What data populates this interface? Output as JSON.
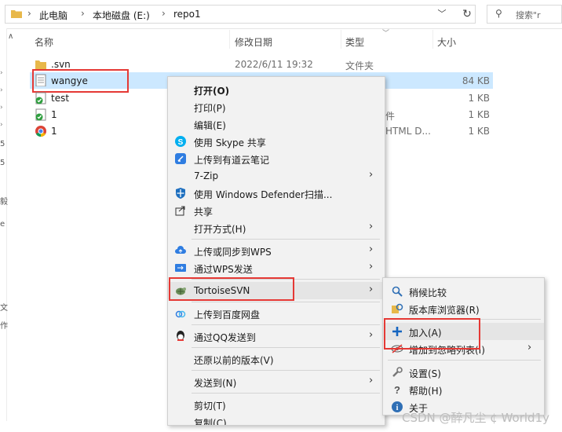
{
  "address_bar": {
    "breadcrumbs": [
      "此电脑",
      "本地磁盘 (E:)",
      "repo1"
    ],
    "search_placeholder": "搜索\"r"
  },
  "nav_fragments": [
    "5",
    "5",
    "毅",
    "e",
    "文",
    "作"
  ],
  "columns": {
    "name": "名称",
    "modified": "修改日期",
    "type": "类型",
    "size": "大小"
  },
  "files": [
    {
      "name": ".svn",
      "modified": "2022/6/11 19:32",
      "type": "文件夹",
      "size": "",
      "icon": "folder-icon"
    },
    {
      "name": "wangye",
      "modified": "",
      "type": "",
      "size": "84 KB",
      "icon": "text-file-icon",
      "selected": true
    },
    {
      "name": "test",
      "modified": "",
      "type": "",
      "size": "1 KB",
      "icon": "svn-file-icon"
    },
    {
      "name": "1",
      "modified": "",
      "type": "件",
      "size": "1 KB",
      "icon": "svn-file-icon"
    },
    {
      "name": "1",
      "modified": "",
      "type": "HTML D...",
      "size": "1 KB",
      "icon": "chrome-icon"
    }
  ],
  "context_menu": {
    "items": [
      {
        "label": "打开(O)",
        "bold": true,
        "icon": ""
      },
      {
        "label": "打印(P)",
        "icon": ""
      },
      {
        "label": "编辑(E)",
        "icon": ""
      },
      {
        "label": "使用 Skype 共享",
        "icon": "skype-icon"
      },
      {
        "label": "上传到有道云笔记",
        "icon": "youdao-icon"
      },
      {
        "label": "7-Zip",
        "icon": "",
        "submenu": true
      },
      {
        "label": "使用 Windows Defender扫描...",
        "icon": "defender-icon"
      },
      {
        "label": "共享",
        "icon": "share-icon"
      },
      {
        "label": "打开方式(H)",
        "icon": "",
        "submenu": true
      },
      {
        "label": "上传或同步到WPS",
        "icon": "wps-cloud-icon",
        "submenu": true
      },
      {
        "label": "通过WPS发送",
        "icon": "wps-send-icon",
        "submenu": true
      },
      {
        "label": "TortoiseSVN",
        "icon": "tortoise-icon",
        "submenu": true
      },
      {
        "label": "上传到百度网盘",
        "icon": "baidu-icon"
      },
      {
        "label": "通过QQ发送到",
        "icon": "qq-icon",
        "submenu": true
      },
      {
        "label": "还原以前的版本(V)",
        "icon": ""
      },
      {
        "label": "发送到(N)",
        "icon": "",
        "submenu": true
      },
      {
        "label": "剪切(T)",
        "icon": ""
      },
      {
        "label": "复制(C)",
        "icon": ""
      }
    ]
  },
  "svn_submenu": {
    "items": [
      {
        "label": "稍候比较",
        "icon": "magnifier-icon"
      },
      {
        "label": "版本库浏览器(R)",
        "icon": "repo-browser-icon"
      },
      {
        "label": "加入(A)",
        "icon": "plus-icon"
      },
      {
        "label": "增加到忽略列表(I)",
        "icon": "ignore-icon",
        "submenu": true
      },
      {
        "label": "设置(S)",
        "icon": "wrench-icon"
      },
      {
        "label": "帮助(H)",
        "icon": "help-icon"
      },
      {
        "label": "关于",
        "icon": "info-icon"
      }
    ]
  },
  "watermark": "CSDN @醉凡尘 ¢ World1y",
  "colors": {
    "selection": "#cce8ff",
    "highlight_box": "#e53935",
    "menu_bg": "#f2f2f2"
  }
}
